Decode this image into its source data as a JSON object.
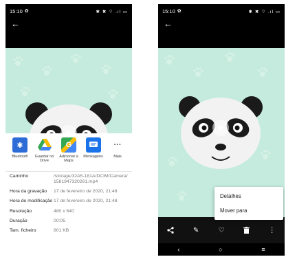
{
  "status_bar": {
    "time": "15:10",
    "icons": "✱ ✖ ⌔ .ıl ▭"
  },
  "share_apps": [
    {
      "label": "Bluetooth",
      "icon": "bluetooth-icon",
      "color": "#2d6bd6",
      "glyph": "✱"
    },
    {
      "label": "Guardar no Drive",
      "icon": "drive-icon",
      "color": "#ffffff",
      "glyph": "▲"
    },
    {
      "label": "Adicionar a Maps",
      "icon": "maps-icon",
      "color": "#34a853",
      "glyph": "G"
    },
    {
      "label": "Mensagens",
      "icon": "messages-icon",
      "color": "#1a73e8",
      "glyph": "▬"
    },
    {
      "label": "Mais",
      "icon": "more-icon",
      "color": "#ffffff",
      "glyph": "···"
    }
  ],
  "details": [
    {
      "key": "Caminho",
      "value": "/storage/32A5-181A/DCIM/Camera/1581947320261.mp4"
    },
    {
      "key": "Hora da gravação",
      "value": "17 de fevereiro de 2020, 21:48"
    },
    {
      "key": "Hora de modificação",
      "value": "17 de fevereiro de 2020, 21:48"
    },
    {
      "key": "Resolução",
      "value": "480 x 640"
    },
    {
      "key": "Duração",
      "value": "00:05"
    },
    {
      "key": "Tam. ficheiro",
      "value": "801 KB"
    }
  ],
  "menu": {
    "details": "Detalhes",
    "move_to": "Mover para"
  },
  "toolbar_icons": [
    "share-icon",
    "edit-icon",
    "favorite-icon",
    "delete-icon",
    "more-vert-icon"
  ],
  "colors": {
    "photo_bg": "#c4ebdd",
    "paw": "#ddf3ea"
  }
}
